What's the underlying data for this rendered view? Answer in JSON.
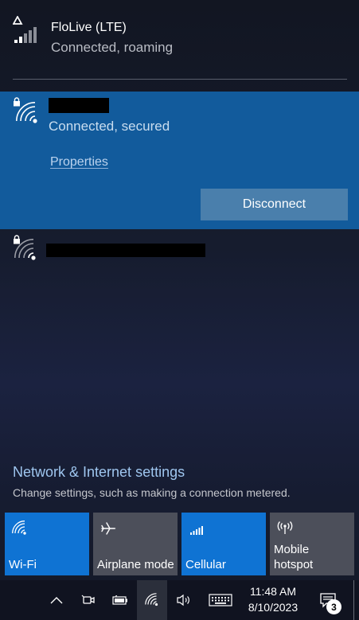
{
  "cellular": {
    "name": "FloLive (LTE)",
    "status": "Connected, roaming",
    "icon": "cellular-signal-roaming-icon"
  },
  "wifi_connected": {
    "ssid_redacted": true,
    "status": "Connected, secured",
    "properties_label": "Properties",
    "disconnect_label": "Disconnect",
    "icons": [
      "lock-icon",
      "wifi-signal-icon"
    ]
  },
  "wifi_other": {
    "ssid_redacted": true,
    "icons": [
      "lock-icon",
      "wifi-signal-icon"
    ]
  },
  "settings": {
    "title": "Network & Internet settings",
    "subtitle": "Change settings, such as making a connection metered."
  },
  "quick_actions": [
    {
      "label": "Wi-Fi",
      "state": "on",
      "icon": "wifi-icon"
    },
    {
      "label": "Airplane mode",
      "state": "off",
      "icon": "airplane-icon"
    },
    {
      "label": "Cellular",
      "state": "on",
      "icon": "cellular-bars-icon"
    },
    {
      "label": "Mobile\nhotspot",
      "label_line1": "Mobile",
      "label_line2": "hotspot",
      "state": "off",
      "icon": "hotspot-icon"
    }
  ],
  "taskbar": {
    "time": "11:48 AM",
    "date": "8/10/2023",
    "notification_count": "3",
    "icons": [
      "chevron-up-icon",
      "meet-now-icon",
      "battery-icon",
      "wifi-icon",
      "volume-icon",
      "keyboard-icon",
      "notification-center-icon"
    ]
  },
  "colors": {
    "accent": "#125b9c",
    "tile_on": "#0f73d3",
    "tile_off": "#4c4f5a",
    "link": "#9fc6ef"
  }
}
